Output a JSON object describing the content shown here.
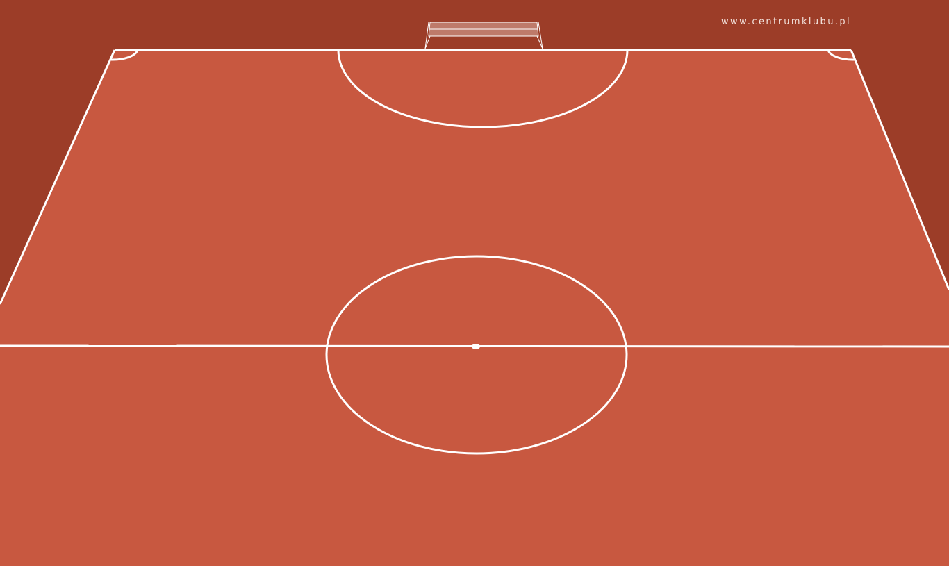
{
  "watermark": "www.centrumklubu.pl",
  "colors": {
    "surround": "#9c3d28",
    "pitch": "#c85840",
    "lines": "#ffffff",
    "goal_net": "#be7a6a"
  }
}
